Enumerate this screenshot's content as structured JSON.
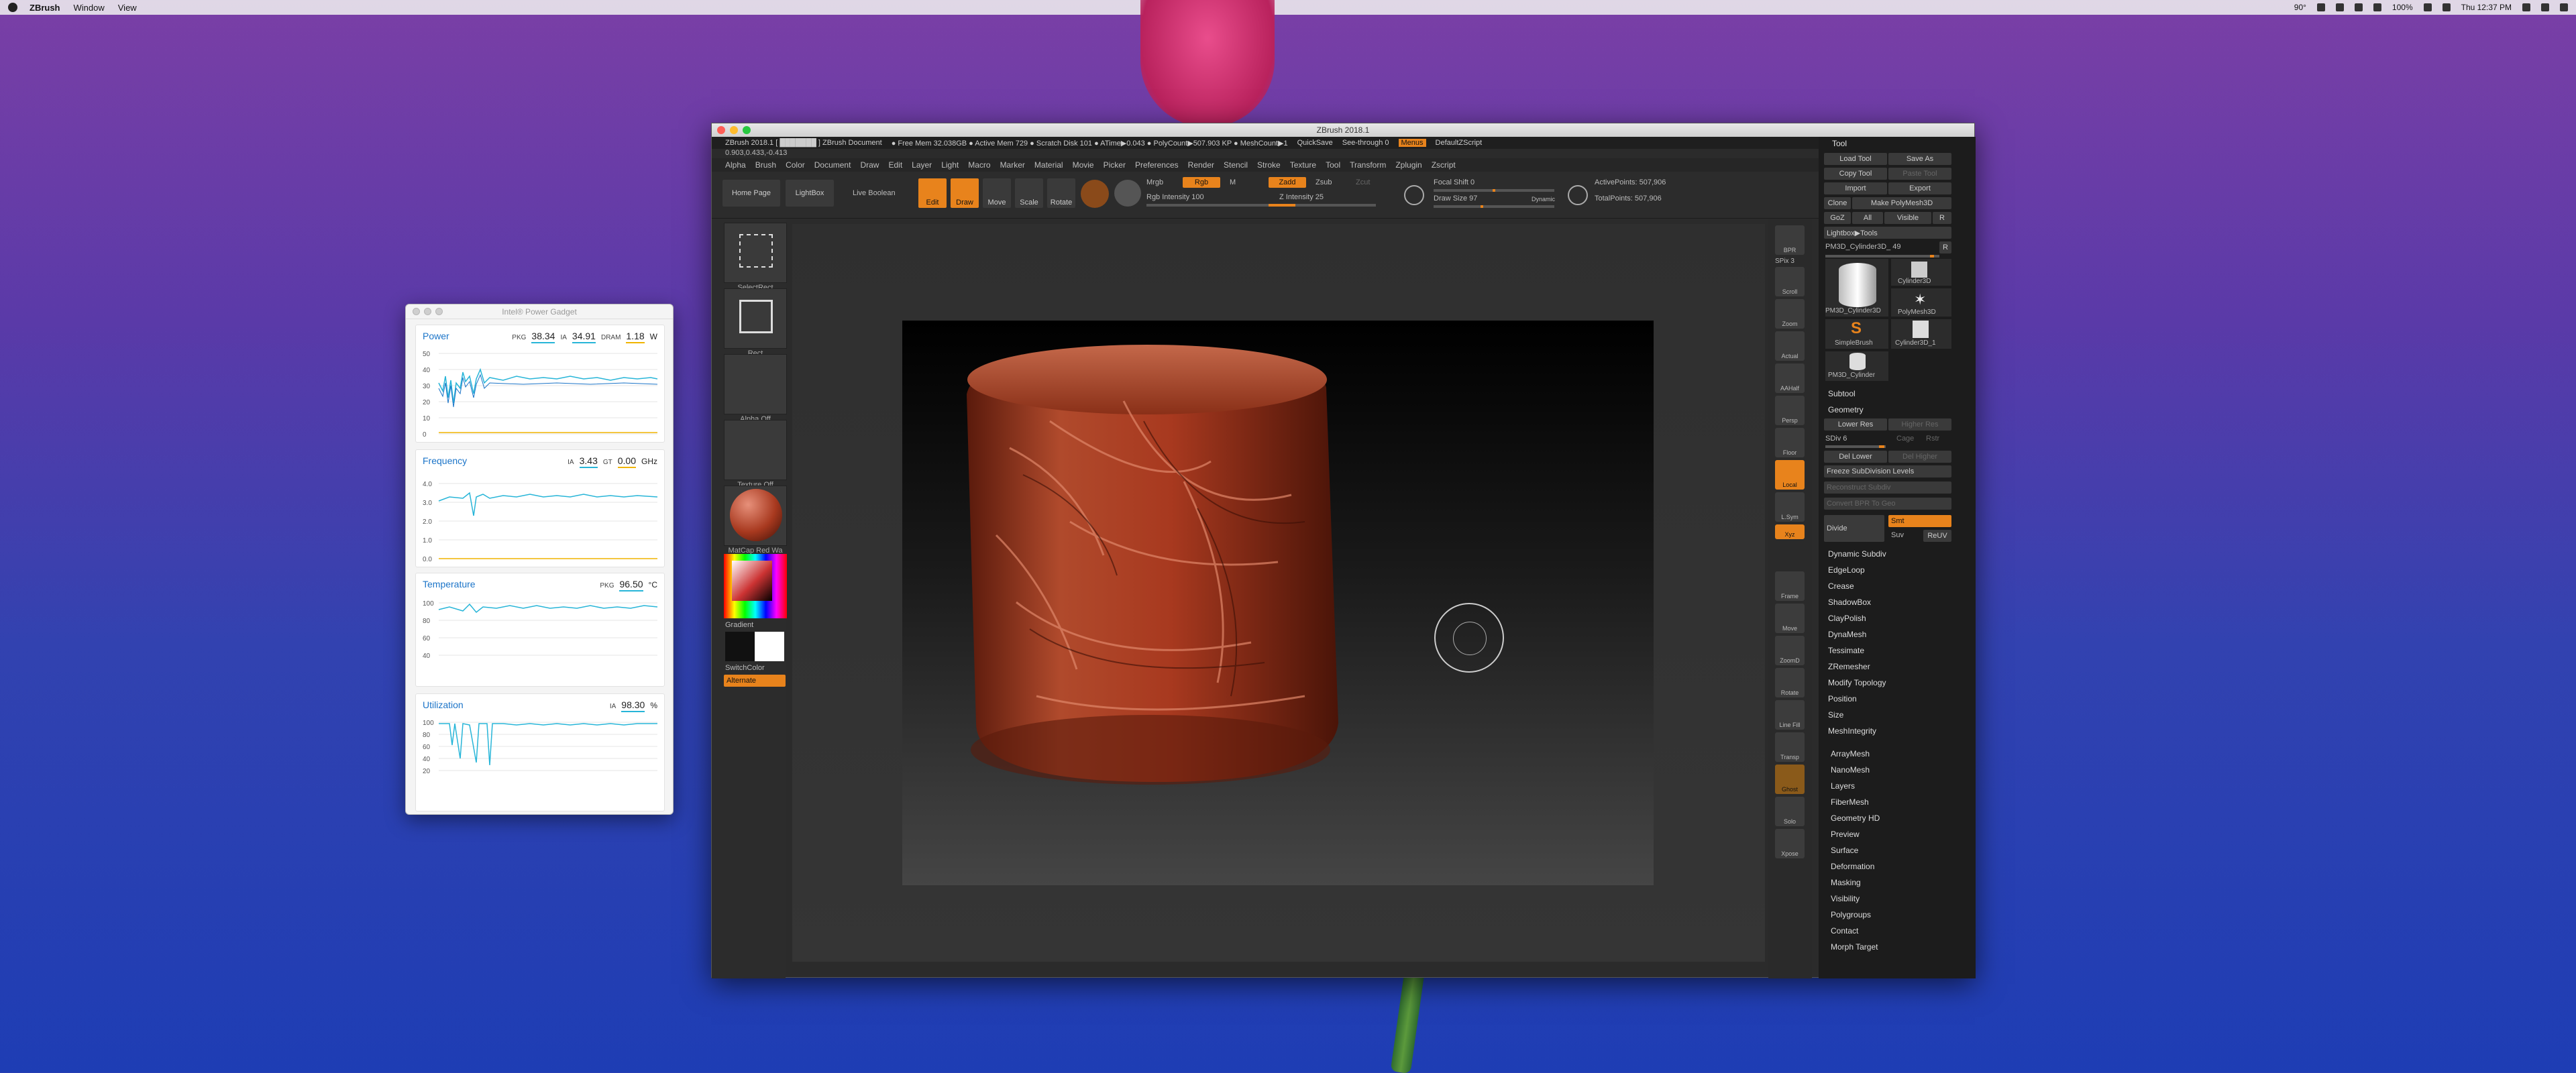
{
  "menubar": {
    "app": "ZBrush",
    "items": [
      "Window",
      "View"
    ],
    "battery": "100%",
    "clock": "Thu 12:37 PM",
    "temp": "90°"
  },
  "power_gadget": {
    "title": "Intel® Power Gadget",
    "power": {
      "label": "Power",
      "pkg_k": "PKG",
      "pkg_v": "38.34",
      "ia_k": "IA",
      "ia_v": "34.91",
      "dram_k": "DRAM",
      "dram_v": "1.18",
      "unit": "W",
      "ticks": [
        "50",
        "40",
        "30",
        "20",
        "10",
        "0"
      ]
    },
    "frequency": {
      "label": "Frequency",
      "ia_k": "IA",
      "ia_v": "3.43",
      "gt_k": "GT",
      "gt_v": "0.00",
      "unit": "GHz",
      "ticks": [
        "4.0",
        "3.0",
        "2.0",
        "1.0",
        "0.0"
      ]
    },
    "temperature": {
      "label": "Temperature",
      "pkg_k": "PKG",
      "pkg_v": "96.50",
      "unit": "°C",
      "ticks": [
        "100",
        "80",
        "60",
        "40"
      ]
    },
    "utilization": {
      "label": "Utilization",
      "ia_k": "IA",
      "ia_v": "98.30",
      "unit": "%",
      "ticks": [
        "100",
        "80",
        "60",
        "40",
        "20"
      ]
    }
  },
  "zbrush": {
    "title": "ZBrush 2018.1",
    "info": {
      "doc": "ZBrush 2018.1 [ ███████ ] ZBrush Document",
      "mem": "● Free Mem 32.038GB ● Active Mem 729 ● Scratch Disk 101 ● ATime▶0.043 ● PolyCount▶507.903 KP ● MeshCount▶1",
      "quicksave": "QuickSave",
      "seethrough": "See-through 0",
      "menus_btn": "Menus",
      "script": "DefaultZScript"
    },
    "coords": "0.903,0.433,-0.413",
    "menus": [
      "Alpha",
      "Brush",
      "Color",
      "Document",
      "Draw",
      "Edit",
      "Layer",
      "Light",
      "Macro",
      "Marker",
      "Material",
      "Movie",
      "Picker",
      "Preferences",
      "Render",
      "Stencil",
      "Stroke",
      "Texture",
      "Tool",
      "Transform",
      "Zplugin",
      "Zscript"
    ],
    "shelf": {
      "home": "Home Page",
      "lightbox": "LightBox",
      "liveboolean": "Live Boolean",
      "edit": "Edit",
      "draw": "Draw",
      "move": "Move",
      "scale": "Scale",
      "rotate": "Rotate",
      "mrgb": "Mrgb",
      "rgb": "Rgb",
      "m": "M",
      "rgb_intensity": "Rgb Intensity 100",
      "zadd": "Zadd",
      "zsub": "Zsub",
      "zcut": "Zcut",
      "z_intensity": "Z Intensity 25",
      "focal_shift": "Focal Shift 0",
      "draw_size": "Draw Size 97",
      "dynamic": "Dynamic",
      "active_points": "ActivePoints: 507,906",
      "total_points": "TotalPoints: 507,906"
    },
    "left": {
      "selectrect": "SelectRect",
      "rect": "Rect",
      "alpha": "Alpha Off",
      "texture": "Texture Off",
      "material": "MatCap Red Wa",
      "gradient": "Gradient",
      "switchcolor": "SwitchColor",
      "alternate": "Alternate"
    },
    "right_tray": [
      "BPR",
      "SPix 3",
      "Scroll",
      "Zoom",
      "Actual",
      "AAHalf",
      "Persp",
      "Floor",
      "Local",
      "L.Sym",
      "Xyz",
      "Frame",
      "Move",
      "ZoomD",
      "Rotate",
      "Line Fill",
      "Transp",
      "Ghost",
      "Solo",
      "Xpose"
    ],
    "tool": {
      "header": "Tool",
      "load": "Load Tool",
      "saveas": "Save As",
      "copy": "Copy Tool",
      "paste": "Paste Tool",
      "import": "Import",
      "export": "Export",
      "clone": "Clone",
      "make_polymesh": "Make PolyMesh3D",
      "goz": "GoZ",
      "all": "All",
      "visible": "Visible",
      "r": "R",
      "lightbox_tools": "Lightbox▶Tools",
      "current": "PM3D_Cylinder3D_ 49",
      "r2": "R",
      "tools": [
        "PM3D_Cylinder3D",
        "Cylinder3D",
        "PolyMesh3D",
        "SimpleBrush",
        "Cylinder3D_1",
        "PM3D_Cylinder"
      ],
      "subtool": "Subtool",
      "geometry": "Geometry",
      "lower_res": "Lower Res",
      "higher_res": "Higher Res",
      "sdiv": "SDiv 6",
      "cage": "Cage",
      "rstr": "Rstr",
      "del_lower": "Del Lower",
      "del_higher": "Del Higher",
      "freeze": "Freeze SubDivision Levels",
      "reconstruct": "Reconstruct Subdiv",
      "convert_bpr": "Convert BPR To Geo",
      "divide": "Divide",
      "smt": "Smt",
      "suv": "Suv",
      "reuv": "ReUV",
      "geo_items": [
        "Dynamic Subdiv",
        "EdgeLoop",
        "Crease",
        "ShadowBox",
        "ClayPolish",
        "DynaMesh",
        "Tessimate",
        "ZRemesher",
        "Modify Topology",
        "Position",
        "Size",
        "MeshIntegrity"
      ],
      "sections": [
        "ArrayMesh",
        "NanoMesh",
        "Layers",
        "FiberMesh",
        "Geometry HD",
        "Preview",
        "Surface",
        "Deformation",
        "Masking",
        "Visibility",
        "Polygroups",
        "Contact",
        "Morph Target"
      ]
    }
  },
  "colors": {
    "accent": "#e8831c",
    "cyan": "#27b5d8",
    "sculpt": "#a8391f"
  }
}
